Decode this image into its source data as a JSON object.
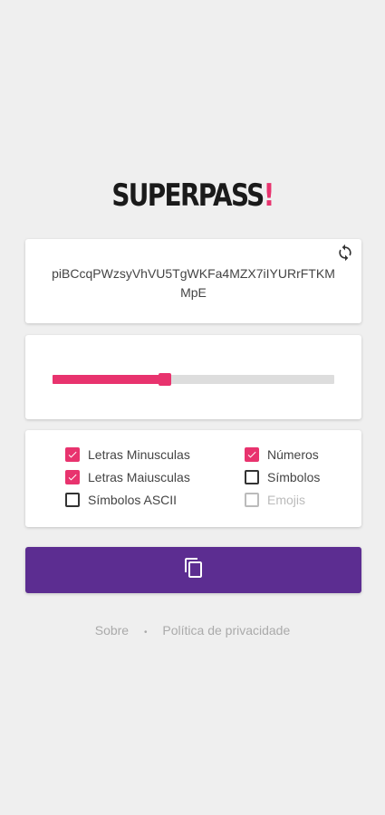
{
  "logo": {
    "text": "SUPERPASS",
    "accent": "!"
  },
  "password": {
    "value": "piBCcqPWzsyVhVU5TgWKFa4MZX7iIYURrFTKMMpE"
  },
  "length_slider": {
    "fraction": 0.4
  },
  "options": [
    {
      "label": "Letras Minusculas",
      "checked": true,
      "disabled": false
    },
    {
      "label": "Números",
      "checked": true,
      "disabled": false
    },
    {
      "label": "Letras Maiusculas",
      "checked": true,
      "disabled": false
    },
    {
      "label": "Símbolos",
      "checked": false,
      "disabled": false
    },
    {
      "label": "Símbolos ASCII",
      "checked": false,
      "disabled": false
    },
    {
      "label": "Emojis",
      "checked": false,
      "disabled": true
    }
  ],
  "footer": {
    "about": "Sobre",
    "separator": "•",
    "privacy": "Política de privacidade"
  },
  "colors": {
    "accent": "#e8336e",
    "primary": "#5c2d91",
    "background": "#efefef"
  },
  "icons": {
    "refresh": "refresh-icon",
    "copy": "copy-icon"
  }
}
